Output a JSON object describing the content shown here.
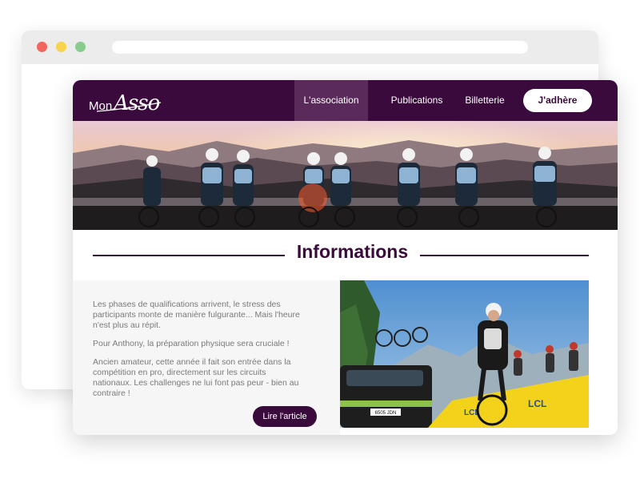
{
  "site": {
    "logo": {
      "part1": "Mon",
      "part2": "Asso"
    },
    "nav": {
      "items": [
        {
          "label": "L'association",
          "active": true
        },
        {
          "label": "Publications",
          "active": false
        },
        {
          "label": "Billetterie",
          "active": false
        }
      ],
      "cta_label": "J'adhère"
    },
    "section_title": "Informations",
    "article": {
      "paragraphs": [
        "Les phases de qualifications arrivent, le stress des participants monte de manière fulgurante... Mais l'heure n'est plus au répit.",
        "Pour Anthony, la préparation physique sera cruciale !",
        "Ancien amateur, cette année il fait son entrée dans la compétition en pro, directement sur les circuits nationaux. Les challenges ne lui font pas peur - bien au contraire !"
      ],
      "button_label": "Lire l'article"
    },
    "photo": {
      "car_plate": "6505 JDN",
      "banner_text": "LCL"
    }
  },
  "colors": {
    "brand": "#3b0a3c",
    "brand_active": "#5a2a5b",
    "text_muted": "#7a7a7a",
    "panel": "#f6f6f6"
  }
}
